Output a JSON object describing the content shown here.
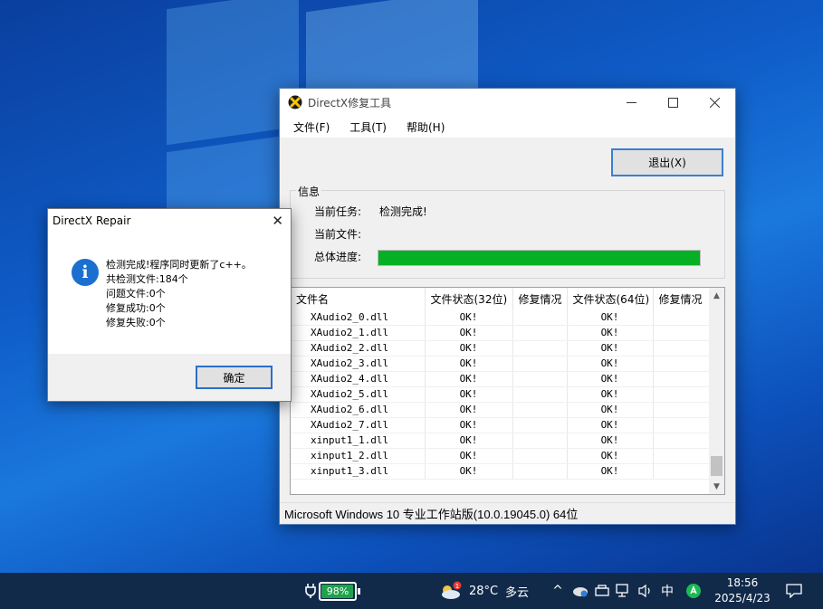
{
  "main_window": {
    "title": "DirectX修复工具",
    "menu": [
      "文件(F)",
      "工具(T)",
      "帮助(H)"
    ],
    "exit_button": "退出(X)",
    "info": {
      "legend": "信息",
      "current_task_label": "当前任务:",
      "current_task_value": "检测完成!",
      "current_file_label": "当前文件:",
      "current_file_value": "",
      "progress_label": "总体进度:",
      "progress_fraction": 1.0
    },
    "table": {
      "headers": [
        "文件名",
        "文件状态(32位)",
        "修复情况",
        "文件状态(64位)",
        "修复情况"
      ],
      "rows": [
        [
          "XAudio2_0.dll",
          "OK!",
          "",
          "OK!",
          ""
        ],
        [
          "XAudio2_1.dll",
          "OK!",
          "",
          "OK!",
          ""
        ],
        [
          "XAudio2_2.dll",
          "OK!",
          "",
          "OK!",
          ""
        ],
        [
          "XAudio2_3.dll",
          "OK!",
          "",
          "OK!",
          ""
        ],
        [
          "XAudio2_4.dll",
          "OK!",
          "",
          "OK!",
          ""
        ],
        [
          "XAudio2_5.dll",
          "OK!",
          "",
          "OK!",
          ""
        ],
        [
          "XAudio2_6.dll",
          "OK!",
          "",
          "OK!",
          ""
        ],
        [
          "XAudio2_7.dll",
          "OK!",
          "",
          "OK!",
          ""
        ],
        [
          "xinput1_1.dll",
          "OK!",
          "",
          "OK!",
          ""
        ],
        [
          "xinput1_2.dll",
          "OK!",
          "",
          "OK!",
          ""
        ],
        [
          "xinput1_3.dll",
          "OK!",
          "",
          "OK!",
          ""
        ]
      ]
    },
    "status_bar": "Microsoft Windows 10 专业工作站版(10.0.19045.0) 64位"
  },
  "message_box": {
    "title": "DirectX Repair",
    "lines": [
      "检测完成!程序同时更新了c++。",
      "共检测文件:184个",
      "问题文件:0个",
      "修复成功:0个",
      "修复失败:0个"
    ],
    "ok_button": "确定",
    "icon": "info-icon"
  },
  "taskbar": {
    "battery_percent": "98%",
    "battery_level": 0.98,
    "weather_temp": "28°C",
    "weather_desc": "多云",
    "weather_badge": "1",
    "ime": "中",
    "time": "18:56",
    "date": "2025/4/23",
    "colors": {
      "background": "#112a4a",
      "battery_fill": "#1fa24a"
    }
  },
  "colors": {
    "progress_fill": "#06b025",
    "accent": "#3c7fd0",
    "info_icon": "#1a6fd0"
  }
}
